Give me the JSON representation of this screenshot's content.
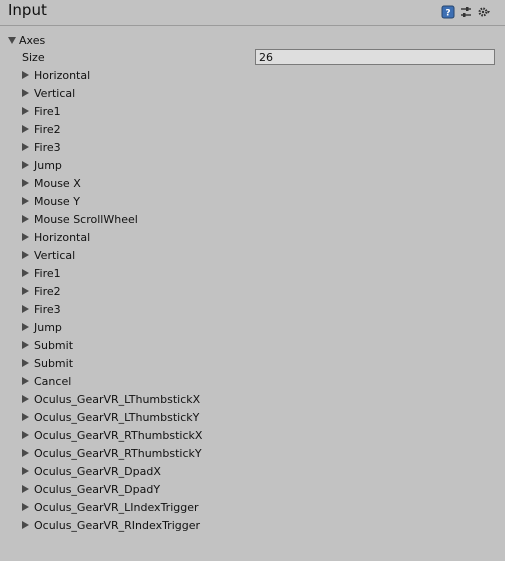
{
  "header": {
    "title": "Input",
    "icons": [
      "help-icon",
      "preset-icon",
      "settings-gear-icon"
    ]
  },
  "axes": {
    "label": "Axes",
    "expanded": true,
    "size_label": "Size",
    "size_value": "26",
    "items": [
      "Horizontal",
      "Vertical",
      "Fire1",
      "Fire2",
      "Fire3",
      "Jump",
      "Mouse X",
      "Mouse Y",
      "Mouse ScrollWheel",
      "Horizontal",
      "Vertical",
      "Fire1",
      "Fire2",
      "Fire3",
      "Jump",
      "Submit",
      "Submit",
      "Cancel",
      "Oculus_GearVR_LThumbstickX",
      "Oculus_GearVR_LThumbstickY",
      "Oculus_GearVR_RThumbstickX",
      "Oculus_GearVR_RThumbstickY",
      "Oculus_GearVR_DpadX",
      "Oculus_GearVR_DpadY",
      "Oculus_GearVR_LIndexTrigger",
      "Oculus_GearVR_RIndexTrigger"
    ]
  }
}
